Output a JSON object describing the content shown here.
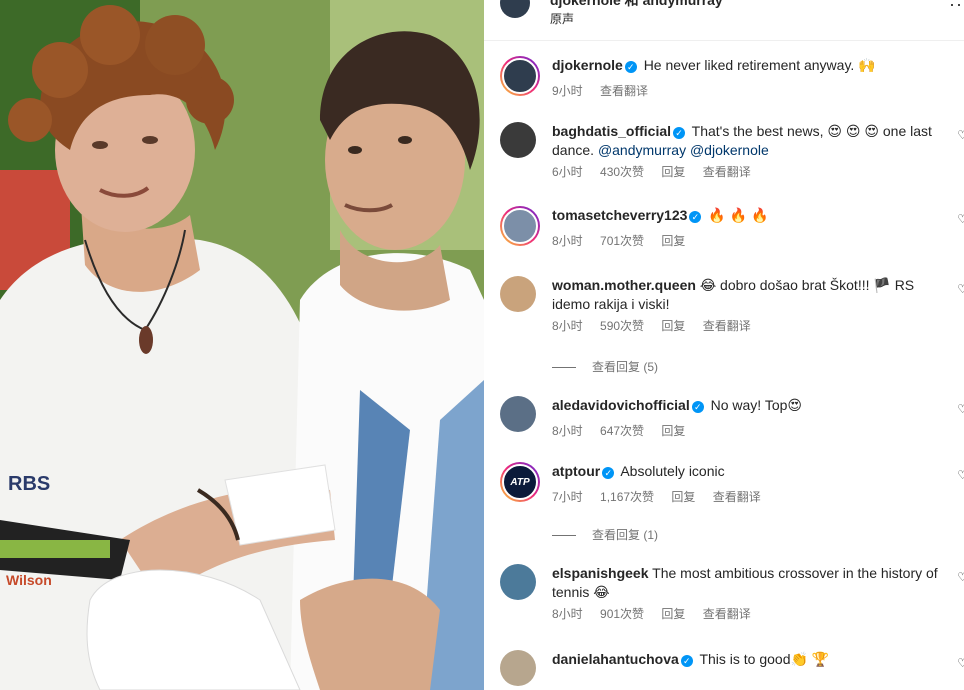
{
  "post": {
    "caption": "djokernole 和 andymurray",
    "audio_label": "原声",
    "more_label": "···"
  },
  "comments": [
    {
      "user": "djokernole",
      "verified": true,
      "text": "He never liked retirement anyway. 🙌",
      "time": "9小时",
      "likes": "",
      "reply": "",
      "translate": "查看翻译",
      "avatar_color": "#2f3d4e"
    },
    {
      "user": "baghdatis_official",
      "verified": true,
      "text": "That's the best news, 😍 😍 😍 one last dance.",
      "mentions": "@andymurray @djokernole",
      "time": "6小时",
      "likes": "430次赞",
      "reply": "回复",
      "translate": "查看翻译",
      "avatar_color": "#3a3a3a"
    },
    {
      "user": "tomasetcheverry123",
      "verified": true,
      "text": "🔥 🔥 🔥",
      "time": "8小时",
      "likes": "701次赞",
      "reply": "回复",
      "translate": "",
      "avatar_color": "#7c8fa8"
    },
    {
      "user": "woman.mother.queen",
      "verified": false,
      "text": "😂 dobro došao brat Škot!!! 🏴 RS idemo rakija i viski!",
      "time": "8小时",
      "likes": "590次赞",
      "reply": "回复",
      "translate": "查看翻译",
      "avatar_color": "#c9a37c"
    },
    {
      "user": "aledavidovichofficial",
      "verified": true,
      "text": "No way! Top😍",
      "time": "8小时",
      "likes": "647次赞",
      "reply": "回复",
      "translate": "",
      "avatar_color": "#5b6f86"
    },
    {
      "user": "atptour",
      "verified": true,
      "text": "Absolutely iconic",
      "time": "7小时",
      "likes": "1,167次赞",
      "reply": "回复",
      "translate": "查看翻译",
      "avatar_color": "#0b1a3a",
      "avatar_text": "ATP"
    },
    {
      "user": "elspanishgeek",
      "verified": false,
      "text": "The most ambitious crossover in the history of tennis 😂",
      "time": "8小时",
      "likes": "901次赞",
      "reply": "回复",
      "translate": "查看翻译",
      "avatar_color": "#4c7a9a"
    },
    {
      "user": "danielahantuchova",
      "verified": true,
      "text": "This is to good👏 🏆",
      "time": "",
      "likes": "",
      "reply": "",
      "translate": "",
      "avatar_color": "#b7a68e"
    }
  ],
  "view_replies": [
    {
      "label": "查看回复 (5)"
    },
    {
      "label": "查看回复 (1)"
    }
  ],
  "photo": {
    "shirt_logo": "RBS",
    "racket_text": "Wilson"
  }
}
